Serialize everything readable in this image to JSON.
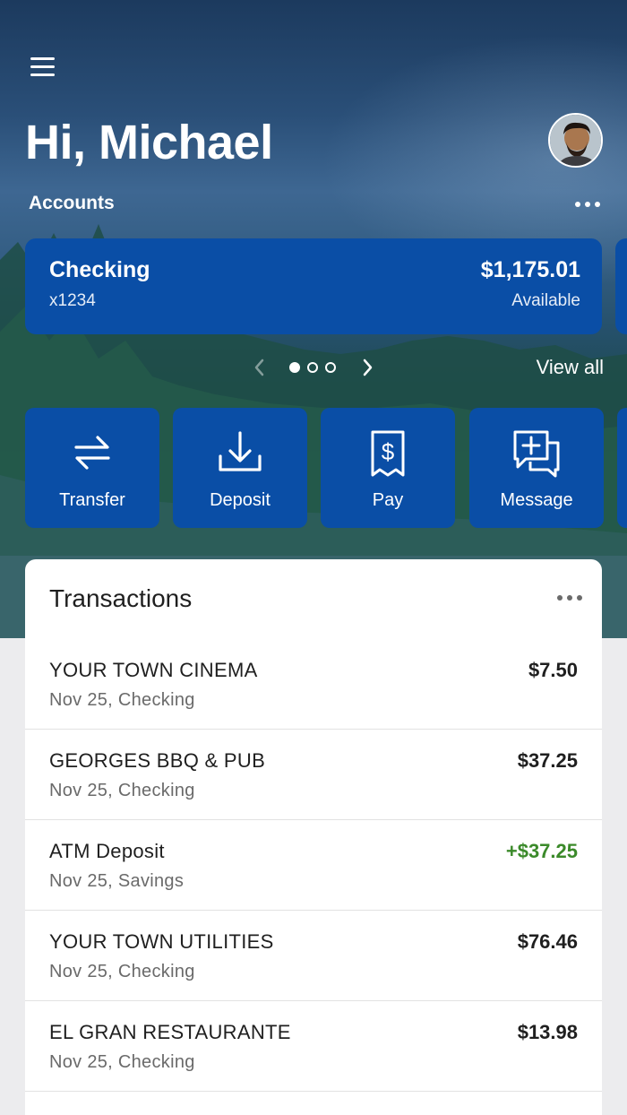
{
  "header": {
    "greeting": "Hi, Michael",
    "accounts_label": "Accounts"
  },
  "accounts": [
    {
      "name": "Checking",
      "number": "x1234",
      "balance": "$1,175.01",
      "balance_label": "Available"
    }
  ],
  "pager": {
    "view_all_label": "View all",
    "page_count": 3,
    "active_page": 1
  },
  "actions": [
    {
      "label": "Transfer",
      "icon": "transfer-icon"
    },
    {
      "label": "Deposit",
      "icon": "deposit-icon"
    },
    {
      "label": "Pay",
      "icon": "pay-bill-icon"
    },
    {
      "label": "Message",
      "icon": "message-icon"
    }
  ],
  "transactions": {
    "title": "Transactions",
    "items": [
      {
        "name": "YOUR TOWN CINEMA",
        "detail": "Nov 25, Checking",
        "amount": "$7.50",
        "type": "debit"
      },
      {
        "name": "GEORGES BBQ & PUB",
        "detail": "Nov 25, Checking",
        "amount": "$37.25",
        "type": "debit"
      },
      {
        "name": "ATM Deposit",
        "detail": "Nov 25, Savings",
        "amount": "+$37.25",
        "type": "credit"
      },
      {
        "name": "YOUR TOWN UTILITIES",
        "detail": "Nov 25, Checking",
        "amount": "$76.46",
        "type": "debit"
      },
      {
        "name": "EL GRAN RESTAURANTE",
        "detail": "Nov 25, Checking",
        "amount": "$13.98",
        "type": "debit"
      }
    ]
  },
  "colors": {
    "brand_blue": "#0a4ea6",
    "credit_green": "#3b8a2a"
  }
}
